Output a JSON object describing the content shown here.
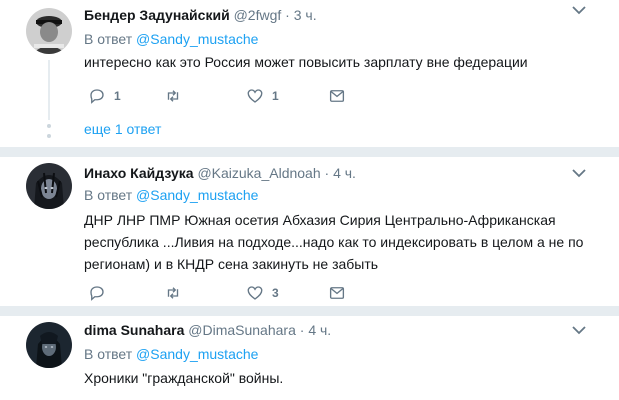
{
  "tweets": [
    {
      "name": "Бендер Задунайский",
      "handle": "@2fwgf",
      "dot": "·",
      "time": "3 ч.",
      "reply_prefix": "В ответ",
      "reply_mention": "@Sandy_mustache",
      "text": "интересно как это Россия может повысить зарплату вне федерации",
      "reply_count": "1",
      "retweet_count": "",
      "like_count": "1",
      "show_more": "еще 1 ответ"
    },
    {
      "name": "Инахо Кайдзука",
      "handle": "@Kaizuka_Aldnoah",
      "dot": "·",
      "time": "4 ч.",
      "reply_prefix": "В ответ",
      "reply_mention": "@Sandy_mustache",
      "text": "ДНР ЛНР ПМР Южная осетия Абхазия Сирия Центрально-Африканская республика ...Ливия на подходе...надо как то индексировать в целом а не по регионам) и в КНДР сена закинуть не забыть",
      "reply_count": "",
      "retweet_count": "",
      "like_count": "3"
    },
    {
      "name": "dima Sunahara",
      "handle": "@DimaSunahara",
      "dot": "·",
      "time": "4 ч.",
      "reply_prefix": "В ответ",
      "reply_mention": "@Sandy_mustache",
      "text": "Хроники \"гражданской\" войны."
    }
  ],
  "colors": {
    "link": "#1da1f2",
    "muted": "#657786",
    "separator": "#e6ecf0"
  },
  "icons": [
    "reply-icon",
    "retweet-icon",
    "like-icon",
    "message-icon",
    "chevron-down-icon"
  ]
}
